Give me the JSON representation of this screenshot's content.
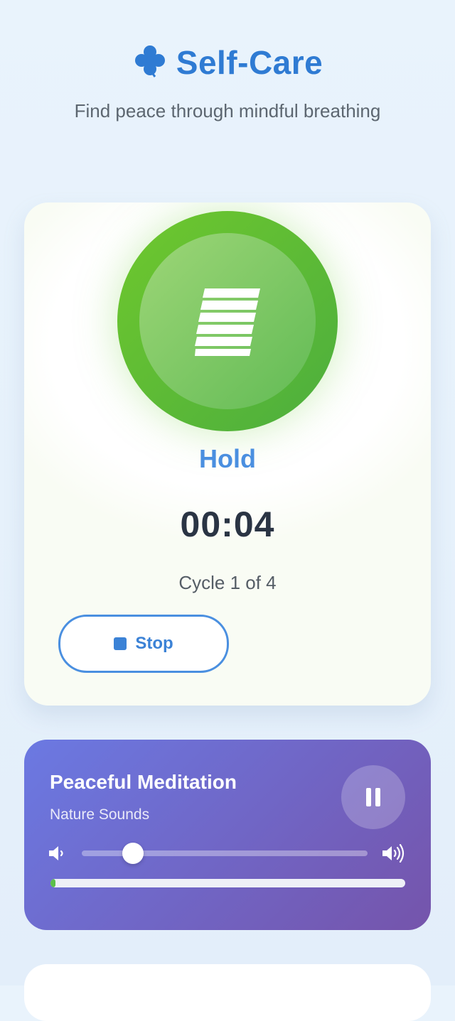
{
  "header": {
    "logo_icon": "four-leaf-clover-icon",
    "title": "Self-Care",
    "subtitle": "Find peace through mindful breathing"
  },
  "breathing": {
    "phase_icon": "lungs-icon",
    "phase": "Hold",
    "timer": "00:04",
    "cycle": "Cycle 1 of 4",
    "stop_icon": "stop-icon",
    "stop_label": "Stop",
    "accent_color": "#4cae3e"
  },
  "player": {
    "title": "Peaceful Meditation",
    "subtitle": "Nature Sounds",
    "pause_icon": "pause-icon",
    "volume_low_icon": "volume-low-icon",
    "volume_high_icon": "volume-high-icon",
    "volume_percent": 18,
    "progress_percent": 1,
    "progress_color": "#5cc04a"
  }
}
